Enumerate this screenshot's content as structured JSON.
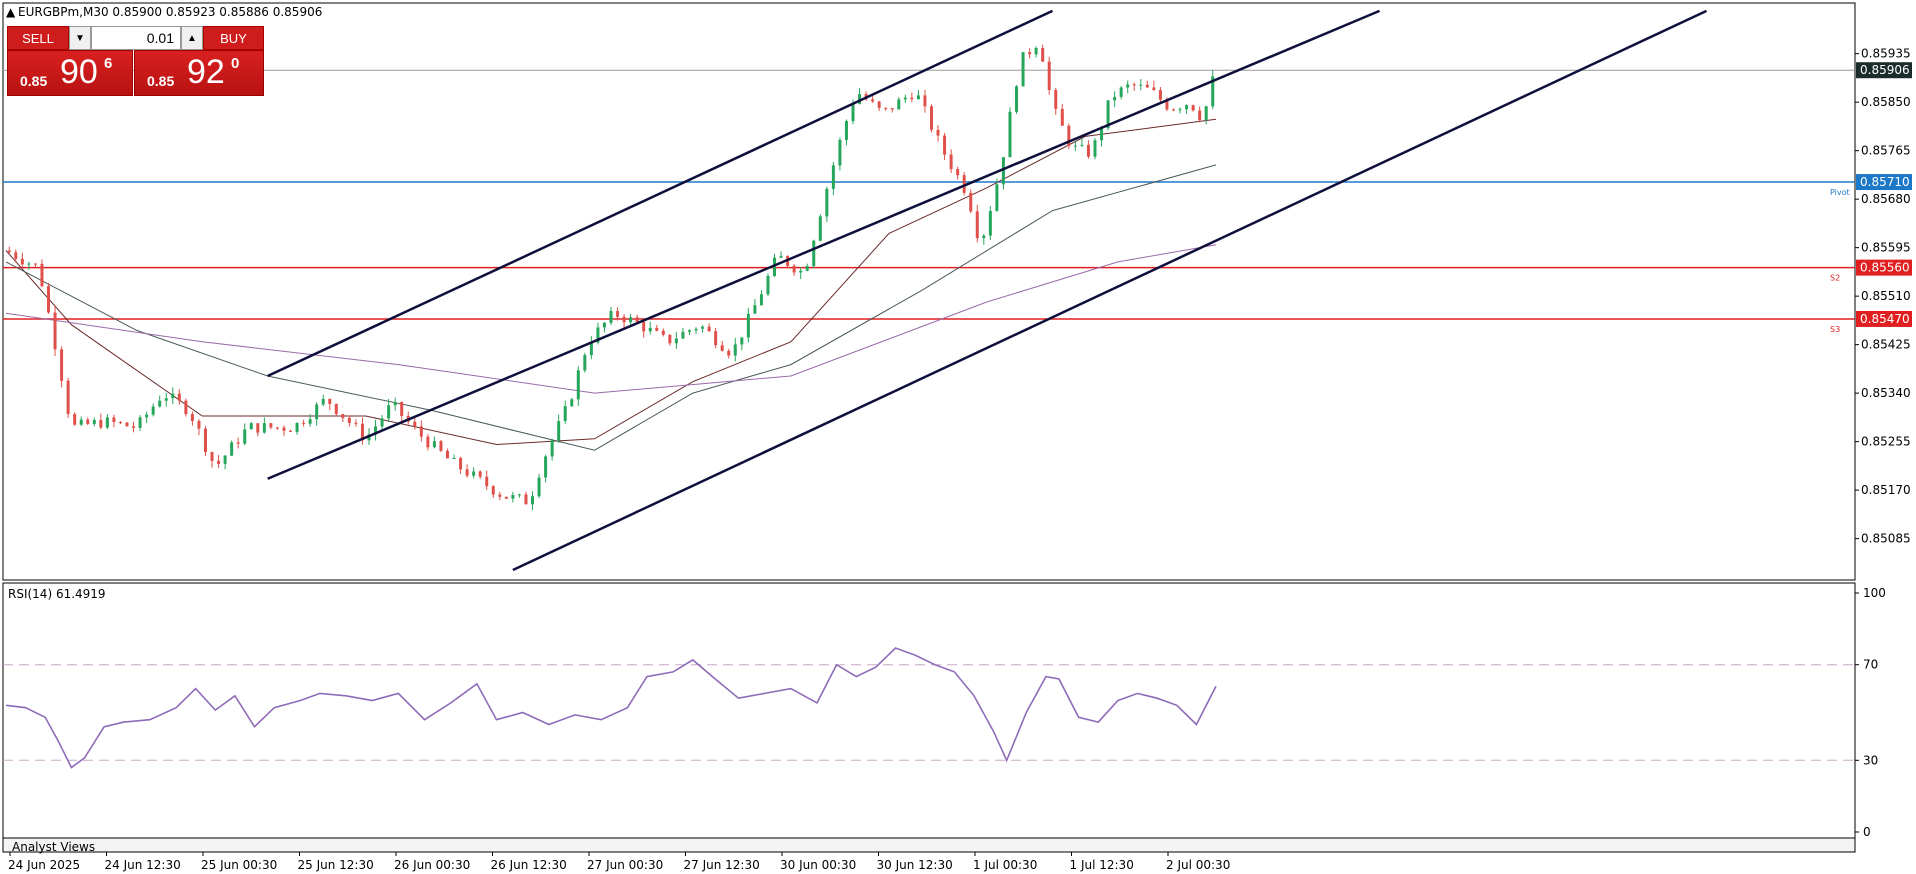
{
  "header": {
    "symbol_info": "EURGBPm,M30  0.85900 0.85923 0.85886 0.85906"
  },
  "trade_panel": {
    "sell_label": "SELL",
    "buy_label": "BUY",
    "lot_value": "0.01",
    "sell_price_small": "0.85",
    "sell_price_big": "90",
    "sell_price_sup": "6",
    "buy_price_small": "0.85",
    "buy_price_big": "92",
    "buy_price_sup": "0"
  },
  "indicator": {
    "label": "RSI(14) 61.4919"
  },
  "bottom_tab": "Analyst Views",
  "colors": {
    "bull": "#26a65b",
    "bear": "#e0504a",
    "pivot": "#1e78c8",
    "support": "#e02020",
    "channel": "#0f0f3d",
    "rsi": "#8e6bb8",
    "ma_fast": "#6b2a2a",
    "ma_mid": "#4a5a5a",
    "ma_slow": "#9a6aa8"
  },
  "chart_data": [
    {
      "type": "candlestick",
      "y_ticks": [
        "0.85935",
        "0.85850",
        "0.85765",
        "0.85680",
        "0.85595",
        "0.85510",
        "0.85425",
        "0.85340",
        "0.85255",
        "0.85170",
        "0.85085"
      ],
      "ylim": [
        0.8503,
        0.8598
      ],
      "x_tick_labels": [
        "24 Jun 2025",
        "24 Jun 12:30",
        "25 Jun 00:30",
        "25 Jun 12:30",
        "26 Jun 00:30",
        "26 Jun 12:30",
        "27 Jun 00:30",
        "27 Jun 12:30",
        "30 Jun 00:30",
        "30 Jun 12:30",
        "1 Jul 00:30",
        "1 Jul 12:30",
        "2 Jul 00:30"
      ],
      "current_price": "0.85906",
      "levels": [
        {
          "name": "Pivot",
          "value": "0.85710",
          "kind": "pivot"
        },
        {
          "name": "S2",
          "value": "0.85560",
          "kind": "support"
        },
        {
          "name": "S3",
          "value": "0.85470",
          "kind": "support"
        }
      ],
      "close_series": [
        {
          "t": 0,
          "v": 0.8559
        },
        {
          "t": 10,
          "v": 0.8556
        },
        {
          "t": 16,
          "v": 0.854
        },
        {
          "t": 20,
          "v": 0.8528
        },
        {
          "t": 30,
          "v": 0.8529
        },
        {
          "t": 40,
          "v": 0.8528
        },
        {
          "t": 48,
          "v": 0.8534
        },
        {
          "t": 56,
          "v": 0.8531
        },
        {
          "t": 64,
          "v": 0.8521
        },
        {
          "t": 74,
          "v": 0.8528
        },
        {
          "t": 88,
          "v": 0.8528
        },
        {
          "t": 98,
          "v": 0.8533
        },
        {
          "t": 110,
          "v": 0.8526
        },
        {
          "t": 118,
          "v": 0.8532
        },
        {
          "t": 126,
          "v": 0.8527
        },
        {
          "t": 136,
          "v": 0.8522
        },
        {
          "t": 144,
          "v": 0.8519
        },
        {
          "t": 152,
          "v": 0.8516
        },
        {
          "t": 160,
          "v": 0.8515
        },
        {
          "t": 164,
          "v": 0.8522
        },
        {
          "t": 172,
          "v": 0.8532
        },
        {
          "t": 178,
          "v": 0.8543
        },
        {
          "t": 186,
          "v": 0.8548
        },
        {
          "t": 194,
          "v": 0.8546
        },
        {
          "t": 202,
          "v": 0.8543
        },
        {
          "t": 212,
          "v": 0.8546
        },
        {
          "t": 222,
          "v": 0.8541
        },
        {
          "t": 228,
          "v": 0.8548
        },
        {
          "t": 236,
          "v": 0.8558
        },
        {
          "t": 244,
          "v": 0.8555
        },
        {
          "t": 250,
          "v": 0.8568
        },
        {
          "t": 256,
          "v": 0.858
        },
        {
          "t": 260,
          "v": 0.8587
        },
        {
          "t": 268,
          "v": 0.8583
        },
        {
          "t": 278,
          "v": 0.8587
        },
        {
          "t": 286,
          "v": 0.8577
        },
        {
          "t": 294,
          "v": 0.8569
        },
        {
          "t": 298,
          "v": 0.856
        },
        {
          "t": 304,
          "v": 0.8573
        },
        {
          "t": 310,
          "v": 0.8592
        },
        {
          "t": 316,
          "v": 0.8596
        },
        {
          "t": 320,
          "v": 0.8584
        },
        {
          "t": 326,
          "v": 0.8577
        },
        {
          "t": 332,
          "v": 0.8576
        },
        {
          "t": 338,
          "v": 0.8586
        },
        {
          "t": 344,
          "v": 0.8588
        },
        {
          "t": 350,
          "v": 0.8587
        },
        {
          "t": 356,
          "v": 0.8584
        },
        {
          "t": 362,
          "v": 0.8585
        },
        {
          "t": 366,
          "v": 0.8582
        },
        {
          "t": 370,
          "v": 0.8591
        }
      ],
      "moving_averages": [
        {
          "name": "MA fast",
          "points": [
            {
              "t": 0,
              "v": 0.8559
            },
            {
              "t": 20,
              "v": 0.8546
            },
            {
              "t": 60,
              "v": 0.853
            },
            {
              "t": 110,
              "v": 0.853
            },
            {
              "t": 150,
              "v": 0.8525
            },
            {
              "t": 180,
              "v": 0.8526
            },
            {
              "t": 210,
              "v": 0.8536
            },
            {
              "t": 240,
              "v": 0.8543
            },
            {
              "t": 270,
              "v": 0.8562
            },
            {
              "t": 300,
              "v": 0.857
            },
            {
              "t": 330,
              "v": 0.8579
            },
            {
              "t": 370,
              "v": 0.8582
            }
          ]
        },
        {
          "name": "MA mid",
          "points": [
            {
              "t": 0,
              "v": 0.8557
            },
            {
              "t": 40,
              "v": 0.8545
            },
            {
              "t": 80,
              "v": 0.8537
            },
            {
              "t": 130,
              "v": 0.8531
            },
            {
              "t": 180,
              "v": 0.8524
            },
            {
              "t": 210,
              "v": 0.8534
            },
            {
              "t": 240,
              "v": 0.8539
            },
            {
              "t": 280,
              "v": 0.8552
            },
            {
              "t": 320,
              "v": 0.8566
            },
            {
              "t": 370,
              "v": 0.8574
            }
          ]
        },
        {
          "name": "MA slow",
          "points": [
            {
              "t": 0,
              "v": 0.8548
            },
            {
              "t": 60,
              "v": 0.8543
            },
            {
              "t": 120,
              "v": 0.8539
            },
            {
              "t": 180,
              "v": 0.8534
            },
            {
              "t": 240,
              "v": 0.8537
            },
            {
              "t": 300,
              "v": 0.855
            },
            {
              "t": 340,
              "v": 0.8557
            },
            {
              "t": 370,
              "v": 0.856
            }
          ]
        }
      ],
      "channel_lines": [
        {
          "from": {
            "t": 80,
            "v": 0.8537
          },
          "to": {
            "t": 320,
            "v": 0.8601
          }
        },
        {
          "from": {
            "t": 80,
            "v": 0.8519
          },
          "to": {
            "t": 420,
            "v": 0.8601
          }
        },
        {
          "from": {
            "t": 155,
            "v": 0.8503
          },
          "to": {
            "t": 520,
            "v": 0.8601
          }
        }
      ]
    },
    {
      "type": "line",
      "title": "RSI(14) 61.4919",
      "ylim": [
        0,
        100
      ],
      "y_ticks": [
        "100",
        "70",
        "30",
        "0"
      ],
      "reference_levels": [
        70,
        30
      ],
      "series": [
        {
          "values": [
            {
              "t": 0,
              "v": 53
            },
            {
              "t": 6,
              "v": 52
            },
            {
              "t": 12,
              "v": 48
            },
            {
              "t": 16,
              "v": 38
            },
            {
              "t": 20,
              "v": 27
            },
            {
              "t": 24,
              "v": 31
            },
            {
              "t": 30,
              "v": 44
            },
            {
              "t": 36,
              "v": 46
            },
            {
              "t": 44,
              "v": 47
            },
            {
              "t": 52,
              "v": 52
            },
            {
              "t": 58,
              "v": 60
            },
            {
              "t": 64,
              "v": 51
            },
            {
              "t": 70,
              "v": 57
            },
            {
              "t": 76,
              "v": 44
            },
            {
              "t": 82,
              "v": 52
            },
            {
              "t": 90,
              "v": 55
            },
            {
              "t": 96,
              "v": 58
            },
            {
              "t": 104,
              "v": 57
            },
            {
              "t": 112,
              "v": 55
            },
            {
              "t": 120,
              "v": 58
            },
            {
              "t": 128,
              "v": 47
            },
            {
              "t": 136,
              "v": 54
            },
            {
              "t": 144,
              "v": 62
            },
            {
              "t": 150,
              "v": 47
            },
            {
              "t": 158,
              "v": 50
            },
            {
              "t": 166,
              "v": 45
            },
            {
              "t": 174,
              "v": 49
            },
            {
              "t": 182,
              "v": 47
            },
            {
              "t": 190,
              "v": 52
            },
            {
              "t": 196,
              "v": 65
            },
            {
              "t": 204,
              "v": 67
            },
            {
              "t": 210,
              "v": 72
            },
            {
              "t": 216,
              "v": 65
            },
            {
              "t": 224,
              "v": 56
            },
            {
              "t": 232,
              "v": 58
            },
            {
              "t": 240,
              "v": 60
            },
            {
              "t": 248,
              "v": 54
            },
            {
              "t": 254,
              "v": 70
            },
            {
              "t": 260,
              "v": 65
            },
            {
              "t": 266,
              "v": 69
            },
            {
              "t": 272,
              "v": 77
            },
            {
              "t": 278,
              "v": 74
            },
            {
              "t": 284,
              "v": 70
            },
            {
              "t": 290,
              "v": 67
            },
            {
              "t": 296,
              "v": 57
            },
            {
              "t": 302,
              "v": 42
            },
            {
              "t": 306,
              "v": 30
            },
            {
              "t": 312,
              "v": 50
            },
            {
              "t": 318,
              "v": 65
            },
            {
              "t": 322,
              "v": 64
            },
            {
              "t": 328,
              "v": 48
            },
            {
              "t": 334,
              "v": 46
            },
            {
              "t": 340,
              "v": 55
            },
            {
              "t": 346,
              "v": 58
            },
            {
              "t": 352,
              "v": 56
            },
            {
              "t": 358,
              "v": 53
            },
            {
              "t": 364,
              "v": 45
            },
            {
              "t": 370,
              "v": 61
            }
          ]
        }
      ]
    }
  ]
}
